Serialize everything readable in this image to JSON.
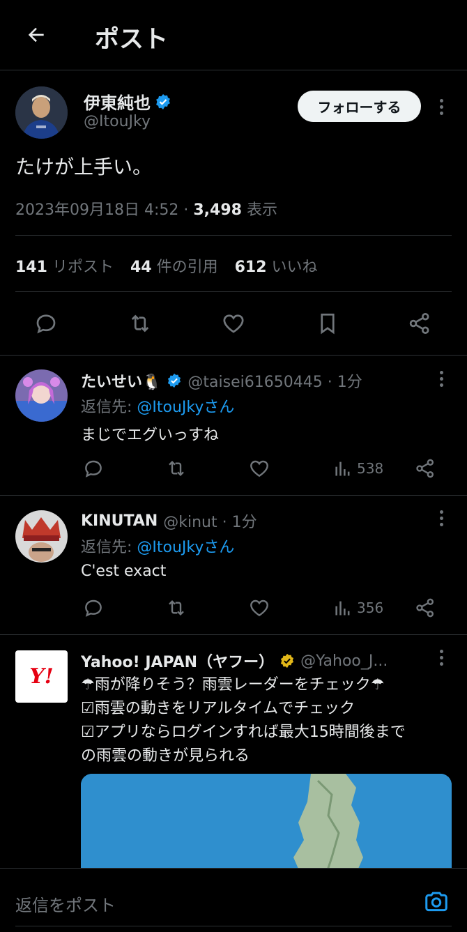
{
  "header": {
    "title": "ポスト"
  },
  "tweet": {
    "author_name": "伊東純也",
    "author_handle": "@ItouJky",
    "follow_label": "フォローする",
    "text": "たけが上手い。",
    "timestamp": "2023年09月18日 4:52 · ",
    "views_count": "3,498",
    "views_label": " 表示",
    "stats": {
      "reposts_count": "141",
      "reposts_label": "リポスト",
      "quotes_count": "44",
      "quotes_label": "件の引用",
      "likes_count": "612",
      "likes_label": "いいね"
    }
  },
  "replies": [
    {
      "name": "たいせい🐧",
      "handle": "@taisei61650445 · 1分",
      "reply_to_prefix": "返信先: ",
      "reply_to_user": "@ItouJkyさん",
      "text": "まじでエグいっすね",
      "views": "538"
    },
    {
      "name": "KINUTAN",
      "handle": "@kinut · 1分",
      "reply_to_prefix": "返信先: ",
      "reply_to_user": "@ItouJkyさん",
      "text": "C'est exact",
      "views": "356"
    }
  ],
  "ad": {
    "name": "Yahoo! JAPAN（ヤフー）",
    "handle": "@Yahoo_J...",
    "logo_text": "Y!",
    "lines": [
      "☂雨が降りそう？雨雲レーダーをチェック☂",
      "☑雨雲の動きをリアルタイムでチェック",
      "☑アプリならログインすれば最大15時間後まで",
      "の雨雲の動きが見られる"
    ]
  },
  "composer": {
    "placeholder": "返信をポスト"
  },
  "colors": {
    "accent": "#1d9bf0",
    "muted": "#71767b",
    "gold": "#e2b719"
  }
}
